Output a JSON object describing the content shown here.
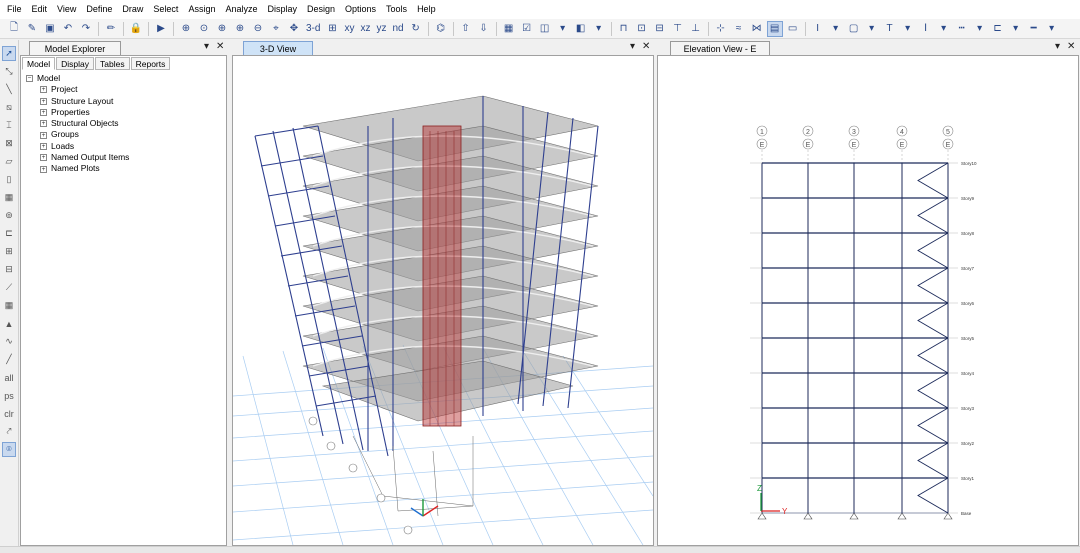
{
  "menu": [
    "File",
    "Edit",
    "View",
    "Define",
    "Draw",
    "Select",
    "Assign",
    "Analyze",
    "Display",
    "Design",
    "Options",
    "Tools",
    "Help"
  ],
  "toolbar": {
    "icons": [
      "new-icon",
      "open-icon",
      "save-icon",
      "undo-icon",
      "redo-icon",
      "pencil-icon",
      "lock-icon",
      "run-icon",
      "zoom-window-icon",
      "zoom-restore-icon",
      "zoom-in-icon",
      "zoom-out-icon",
      "zoom-fit-icon",
      "pan-icon",
      "view-3d-button",
      "view-plan-button",
      "view-elevation-button",
      "rotate-icon",
      "perspective-icon"
    ],
    "labels": {
      "view_3d": "3-d",
      "view_xy": "xy",
      "view_xz": "xz",
      "view_yz": "yz",
      "view_nd": "nd"
    }
  },
  "left_tools": [
    "pointer-icon",
    "reshape-icon",
    "draw-frame-icon",
    "draw-brace-icon",
    "draw-column-icon",
    "quick-draw-icon",
    "draw-area-icon",
    "draw-wall-icon",
    "draw-opening-icon",
    "draw-point-icon",
    "draw-link-icon",
    "draw-grid-icon",
    "draw-dimension-icon",
    "draw-section-cut-icon",
    "select-all-icon",
    "select-prev-icon",
    "clear-selection-icon",
    "snap-icon"
  ],
  "left_tool_labels": {
    "all": "all",
    "ps": "ps",
    "clr": "clr"
  },
  "explorer": {
    "title": "Model Explorer",
    "tabs": [
      "Model",
      "Display",
      "Tables",
      "Reports"
    ],
    "root": "Model",
    "items": [
      "Project",
      "Structure Layout",
      "Properties",
      "Structural Objects",
      "Groups",
      "Loads",
      "Named Output Items",
      "Named Plots"
    ]
  },
  "view3d": {
    "title": "3-D View"
  },
  "elevation": {
    "title": "Elevation View - E",
    "grids": [
      "1",
      "2",
      "3",
      "4",
      "5"
    ],
    "grid_line": "E",
    "stories": [
      "Story10",
      "Story9",
      "Story8",
      "Story7",
      "Story6",
      "Story5",
      "Story4",
      "Story3",
      "Story2",
      "Story1",
      "Base"
    ],
    "axis_x": "Y",
    "axis_z": "Z"
  },
  "panel_controls": {
    "pin": "▾",
    "close": "✕"
  },
  "colors": {
    "frame": "#2e3f8f",
    "core": "#b52a2a",
    "slab": "#8c8c8c",
    "grid_ground": "#9fc3ee",
    "accent": "#1e6ecf"
  }
}
